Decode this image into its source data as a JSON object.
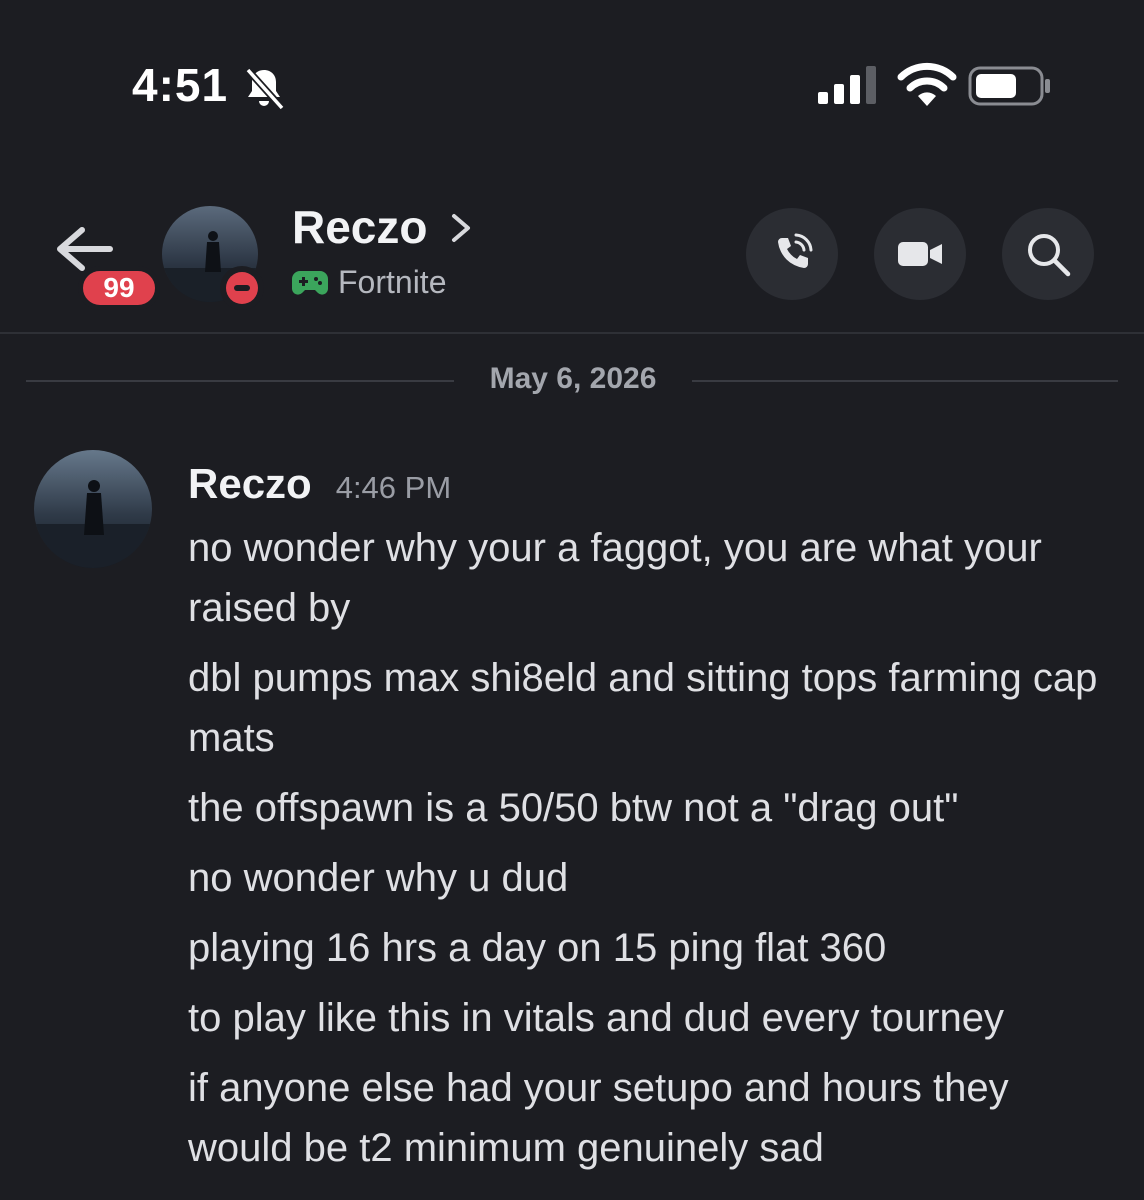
{
  "status_bar": {
    "time": "4:51",
    "icons": [
      "bell-slash-icon",
      "cellular-signal-icon",
      "wifi-icon",
      "battery-icon"
    ]
  },
  "header": {
    "back_icon": "arrow-left-icon",
    "unread_count": "99",
    "contact_name": "Reczo",
    "status": "do-not-disturb",
    "activity_icon": "gamepad-icon",
    "activity": "Fortnite",
    "actions": [
      "phone-call-icon",
      "video-camera-icon",
      "search-icon"
    ]
  },
  "date_divider": "May 6, 2026",
  "message": {
    "author": "Reczo",
    "timestamp": "4:46 PM",
    "lines": [
      "no wonder why your a faggot, you are what your raised by",
      "dbl pumps max shi8eld and sitting tops farming cap mats",
      "the offspawn is a 50/50 btw not a \"drag out\"",
      "no wonder why u dud",
      "playing 16 hrs a day on 15 ping flat 360",
      "to play like this in vitals and dud every tourney",
      "if anyone else had your setupo and hours they would be t2 minimum genuinely sad"
    ]
  },
  "colors": {
    "background": "#1c1d22",
    "badge_red": "#e0414d",
    "gamepad_green": "#3ba55c",
    "button_bg": "#2b2d33"
  }
}
